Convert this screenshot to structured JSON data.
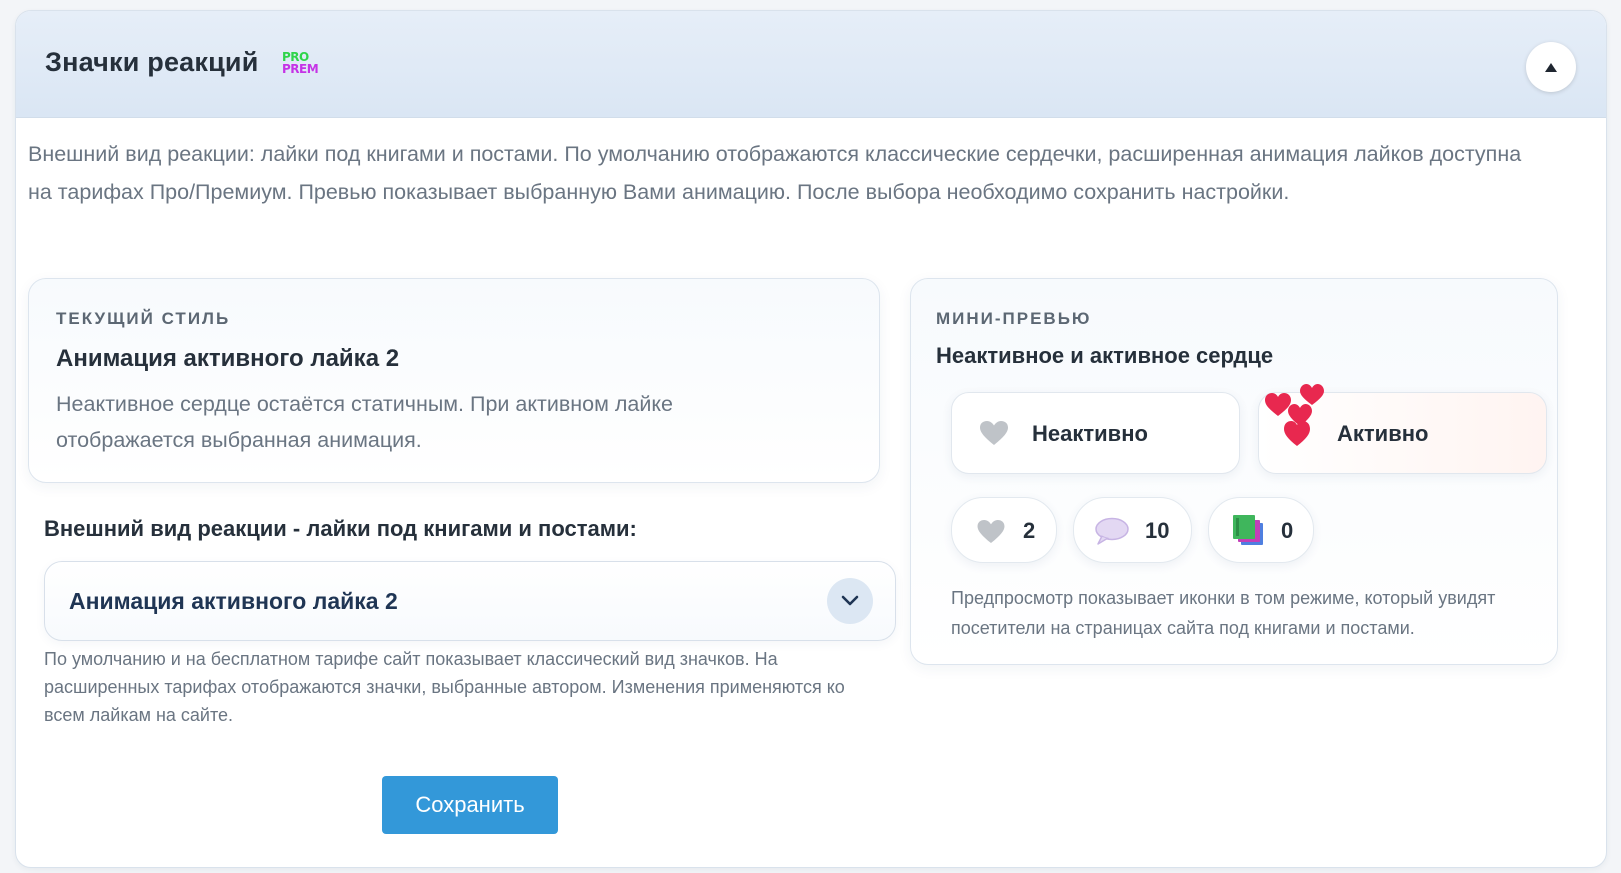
{
  "header": {
    "title": "Значки реакций",
    "badge_pro": "PRO",
    "badge_prem": "PREM",
    "collapse_icon": "triangle-up-icon"
  },
  "intro_text": "Внешний вид реакции: лайки под книгами и постами. По умолчанию отображаются классические сердечки, расширенная анимация лайков доступна на тарифах Про/Премиум. Превью показывает выбранную Вами анимацию. После выбора необходимо сохранить настройки.",
  "current_style": {
    "eyebrow": "ТЕКУЩИЙ СТИЛЬ",
    "title": "Анимация активного лайка 2",
    "description": "Неактивное сердце остаётся статичным. При активном лайке отображается выбранная анимация."
  },
  "selector": {
    "label": "Внешний вид реакции - лайки под книгами и постами:",
    "value": "Анимация активного лайка 2",
    "help": "По умолчанию и на бесплатном тарифе сайт показывает классический вид значков. На расширенных тарифах отображаются значки, выбранные автором. Изменения применяются ко всем лайкам на сайте.",
    "arrow_icon": "chevron-down-icon"
  },
  "save_label": "Сохранить",
  "preview": {
    "eyebrow": "МИНИ-ПРЕВЬЮ",
    "title": "Неактивное и активное сердце",
    "inactive_label": "Неактивно",
    "active_label": "Активно",
    "counters": {
      "likes": "2",
      "comments": "10",
      "books": "0"
    },
    "note": "Предпросмотр показывает иконки в том режиме, который увидят посетители на страницах сайта под книгами и постами."
  },
  "colors": {
    "accent": "#3398d9",
    "heart_active": "#e8284f",
    "heart_inactive": "#bfc3c8",
    "badge_pro": "#2fd44a",
    "badge_prem": "#c533e6"
  }
}
